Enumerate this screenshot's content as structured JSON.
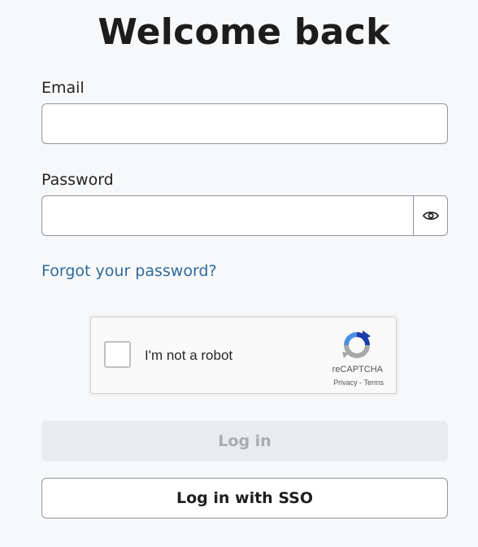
{
  "page": {
    "title": "Welcome back"
  },
  "form": {
    "email_label": "Email",
    "email_value": "",
    "password_label": "Password",
    "password_value": "",
    "toggle_visibility_icon": "eye-icon",
    "forgot_link": "Forgot your password?"
  },
  "captcha": {
    "label": "I'm not a robot",
    "brand": "reCAPTCHA",
    "privacy": "Privacy",
    "separator": " - ",
    "terms": "Terms",
    "checked": false
  },
  "buttons": {
    "login_label": "Log in",
    "login_disabled": true,
    "sso_label": "Log in with SSO"
  },
  "colors": {
    "background": "#f7f8fa",
    "link": "#2f6a9c",
    "disabled_button_bg": "#e9ebee",
    "disabled_button_text": "#a9acb0"
  }
}
